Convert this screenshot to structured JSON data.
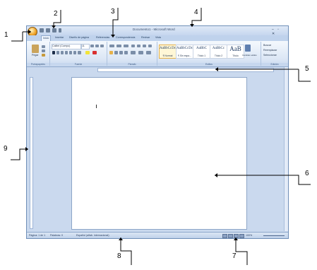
{
  "window": {
    "title": "Documento1 - Microsoft Word",
    "controls": "– ▫ ✕"
  },
  "tabs": [
    "Inicio",
    "Insertar",
    "Diseño de página",
    "Referencias",
    "Correspondencia",
    "Revisar",
    "Vista"
  ],
  "ribbon": {
    "groups": [
      "Portapapeles",
      "Fuente",
      "Párrafo",
      "Estilos",
      "Edición"
    ],
    "paste_label": "Pegar",
    "font_name": "Calibri (Cuerpo)",
    "font_size": "11",
    "styles": [
      {
        "sample": "AaBbCcDc",
        "name": "¶ Normal"
      },
      {
        "sample": "AaBbCcDc",
        "name": "¶ Sin espa..."
      },
      {
        "sample": "AaBbC",
        "name": "Título 1"
      },
      {
        "sample": "AaBbCc",
        "name": "Título 2"
      },
      {
        "sample": "AaB",
        "name": "Título"
      }
    ],
    "change_styles": "Cambiar estilos",
    "edit_items": [
      "Buscar",
      "Reemplazar",
      "Seleccionar"
    ]
  },
  "status": {
    "page": "Página: 1 de 1",
    "words": "Palabras: 0",
    "language": "Español (alfab. internacional)",
    "zoom": "100%"
  },
  "callouts": [
    "1",
    "2",
    "3",
    "4",
    "5",
    "6",
    "7",
    "8",
    "9"
  ],
  "colors": {
    "frame": "#cad9ee",
    "ribbon": "#dce7f5",
    "accent": "#e7b24a"
  }
}
